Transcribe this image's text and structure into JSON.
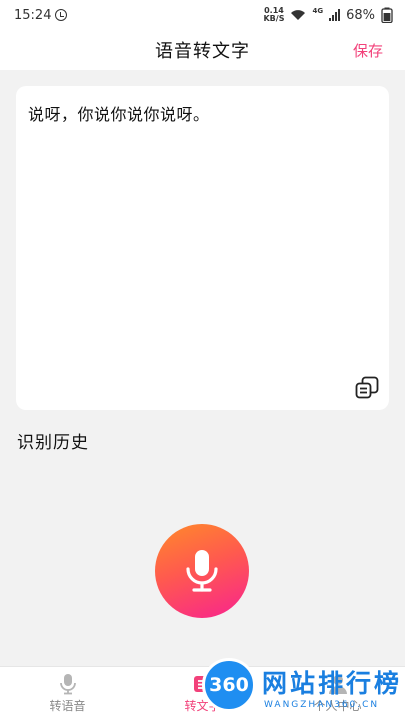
{
  "status_bar": {
    "time": "15:24",
    "net_speed_value": "0.14",
    "net_speed_unit": "KB/S",
    "network_type": "4G",
    "battery": "68%"
  },
  "header": {
    "title": "语音转文字",
    "save_label": "保存"
  },
  "main": {
    "recognized_text": "说呀，你说你说你说呀。",
    "history_label": "识别历史"
  },
  "tabs": [
    {
      "label": "转语音",
      "active": false
    },
    {
      "label": "转文字",
      "active": true
    },
    {
      "label": "个人中心",
      "active": false
    }
  ],
  "watermark": {
    "badge": "360",
    "title": "网站排行榜",
    "subtitle": "WANGZHAN360.CN"
  },
  "colors": {
    "accent": "#f2417a",
    "gradient_start": "#ff8a2a",
    "gradient_end": "#f8238f"
  },
  "icons": {
    "alarm": "alarm-icon",
    "wifi": "wifi-icon",
    "signal": "signal-icon",
    "battery": "battery-icon",
    "copy": "copy-icon",
    "microphone": "microphone-icon"
  }
}
